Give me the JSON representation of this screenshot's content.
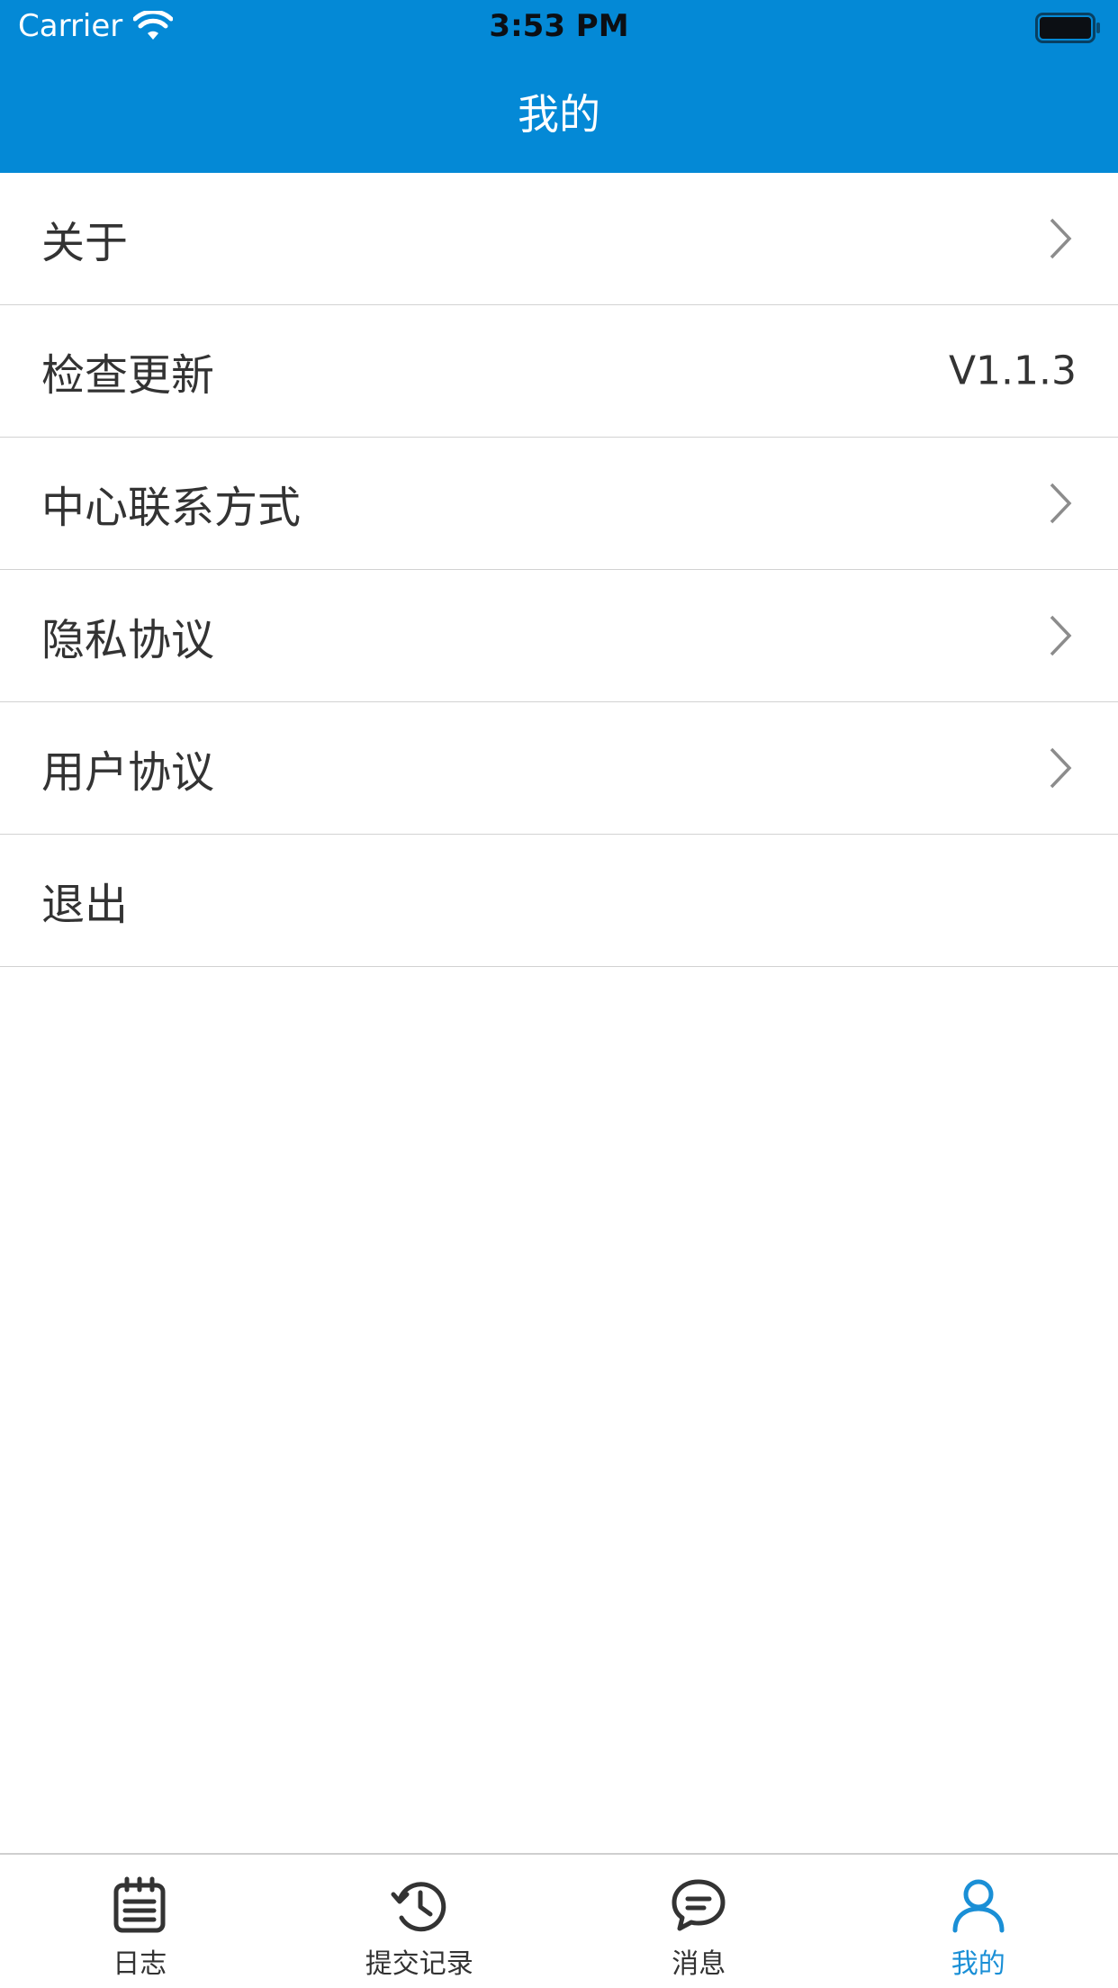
{
  "status_bar": {
    "carrier": "Carrier",
    "time": "3:53 PM"
  },
  "header": {
    "title": "我的"
  },
  "menu": [
    {
      "label": "关于"
    },
    {
      "label": "检查更新",
      "value": "V1.1.3"
    },
    {
      "label": "中心联系方式"
    },
    {
      "label": "隐私协议"
    },
    {
      "label": "用户协议"
    },
    {
      "label": "退出"
    }
  ],
  "tabs": [
    {
      "label": "日志",
      "icon": "journal-icon"
    },
    {
      "label": "提交记录",
      "icon": "history-icon"
    },
    {
      "label": "消息",
      "icon": "message-icon"
    },
    {
      "label": "我的",
      "icon": "user-icon"
    }
  ],
  "colors": {
    "accent": "#0489d6",
    "active_tab": "#1a8fd6"
  }
}
